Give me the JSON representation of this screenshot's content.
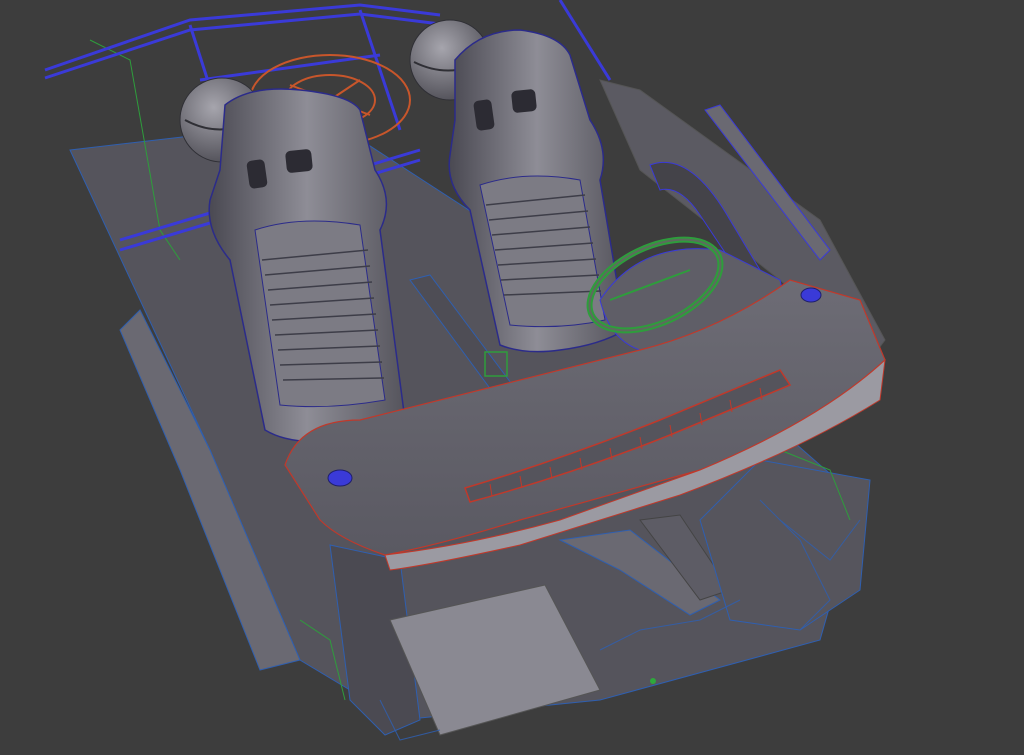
{
  "viewport": {
    "background_color": "#3d3d3d",
    "wire_colors": {
      "roll_cage": "#3a3ad8",
      "dashboard": "#c0392b",
      "steering_wheel": "#2e9d3c",
      "mesh": "#2f5fb0",
      "surface": "#6f6e78"
    }
  }
}
